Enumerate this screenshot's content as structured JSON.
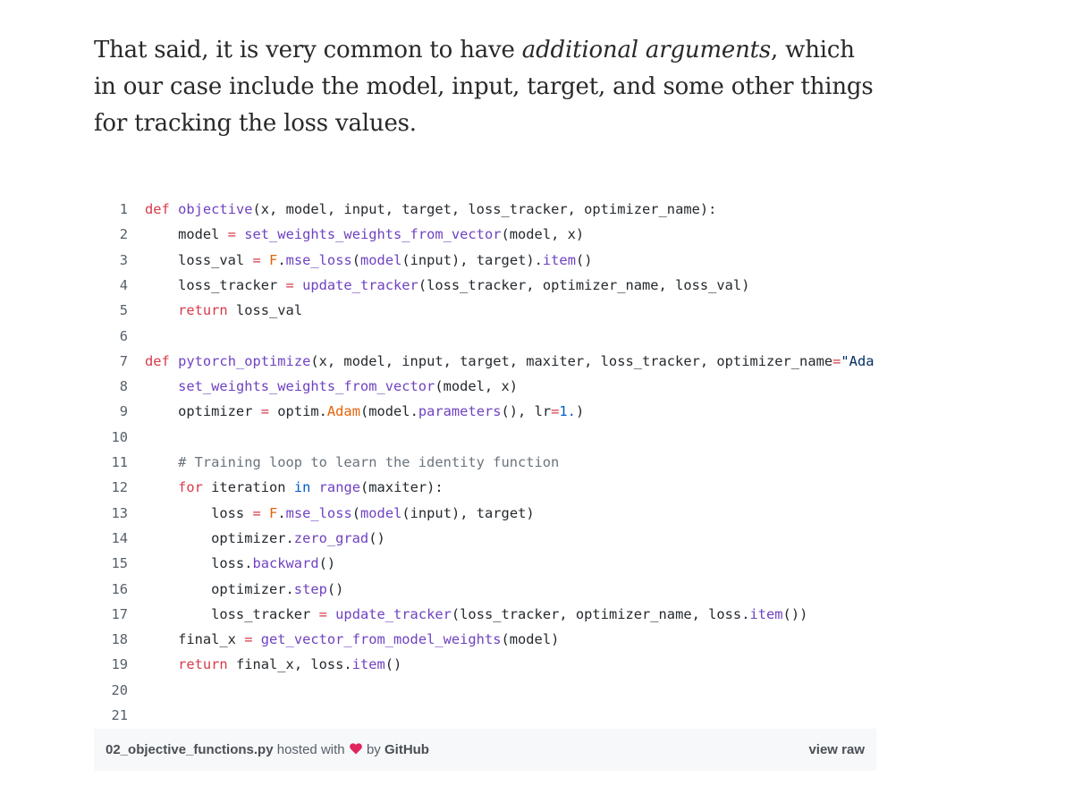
{
  "article": {
    "paragraph_before": "That said, it is very common to have ",
    "paragraph_emphasis": "additional arguments",
    "paragraph_after": ", which in our case include the model, input, target, and some other things for tracking the loss values."
  },
  "gist": {
    "filename": "02_objective_functions.py",
    "hosted_with": "hosted with",
    "by": "by",
    "host": "GitHub",
    "view_raw": "view raw",
    "heart_icon": "heart-icon",
    "colors": {
      "keyword": "#d73a49",
      "function": "#6f42c1",
      "number": "#005cc5",
      "string": "#032f62",
      "comment": "#6a737d",
      "class": "#e36209",
      "meta_background": "#f6f8fa",
      "heart": "#e0245e"
    },
    "lines": [
      {
        "n": "1",
        "tokens": [
          {
            "t": "def",
            "c": "kw"
          },
          {
            "t": " "
          },
          {
            "t": "objective",
            "c": "fn"
          },
          {
            "t": "(x, model, input, target, loss_tracker, optimizer_name):"
          }
        ]
      },
      {
        "n": "2",
        "tokens": [
          {
            "t": "    model "
          },
          {
            "t": "=",
            "c": "kw"
          },
          {
            "t": " "
          },
          {
            "t": "set_weights_weights_from_vector",
            "c": "fn"
          },
          {
            "t": "(model, x)"
          }
        ]
      },
      {
        "n": "3",
        "tokens": [
          {
            "t": "    loss_val "
          },
          {
            "t": "=",
            "c": "kw"
          },
          {
            "t": " "
          },
          {
            "t": "F",
            "c": "cls"
          },
          {
            "t": "."
          },
          {
            "t": "mse_loss",
            "c": "fn"
          },
          {
            "t": "("
          },
          {
            "t": "model",
            "c": "fn"
          },
          {
            "t": "(input), target)."
          },
          {
            "t": "item",
            "c": "fn"
          },
          {
            "t": "()"
          }
        ]
      },
      {
        "n": "4",
        "tokens": [
          {
            "t": "    loss_tracker "
          },
          {
            "t": "=",
            "c": "kw"
          },
          {
            "t": " "
          },
          {
            "t": "update_tracker",
            "c": "fn"
          },
          {
            "t": "(loss_tracker, optimizer_name, loss_val)"
          }
        ]
      },
      {
        "n": "5",
        "tokens": [
          {
            "t": "    "
          },
          {
            "t": "return",
            "c": "kw"
          },
          {
            "t": " loss_val"
          }
        ]
      },
      {
        "n": "6",
        "tokens": []
      },
      {
        "n": "7",
        "tokens": [
          {
            "t": "def",
            "c": "kw"
          },
          {
            "t": " "
          },
          {
            "t": "pytorch_optimize",
            "c": "fn"
          },
          {
            "t": "(x, model, input, target, maxiter, loss_tracker, optimizer_name"
          },
          {
            "t": "=",
            "c": "kw"
          },
          {
            "t": "\"Ada",
            "c": "str"
          }
        ]
      },
      {
        "n": "8",
        "tokens": [
          {
            "t": "    "
          },
          {
            "t": "set_weights_weights_from_vector",
            "c": "fn"
          },
          {
            "t": "(model, x)"
          }
        ]
      },
      {
        "n": "9",
        "tokens": [
          {
            "t": "    optimizer "
          },
          {
            "t": "=",
            "c": "kw"
          },
          {
            "t": " optim."
          },
          {
            "t": "Adam",
            "c": "cls"
          },
          {
            "t": "(model."
          },
          {
            "t": "parameters",
            "c": "fn"
          },
          {
            "t": "(), lr"
          },
          {
            "t": "=",
            "c": "kw"
          },
          {
            "t": "1.",
            "c": "num"
          },
          {
            "t": ")"
          }
        ]
      },
      {
        "n": "10",
        "tokens": []
      },
      {
        "n": "11",
        "tokens": [
          {
            "t": "    "
          },
          {
            "t": "# Training loop to learn the identity function",
            "c": "cm"
          }
        ]
      },
      {
        "n": "12",
        "tokens": [
          {
            "t": "    "
          },
          {
            "t": "for",
            "c": "kw"
          },
          {
            "t": " iteration "
          },
          {
            "t": "in",
            "c": "num"
          },
          {
            "t": " "
          },
          {
            "t": "range",
            "c": "fn"
          },
          {
            "t": "(maxiter):"
          }
        ]
      },
      {
        "n": "13",
        "tokens": [
          {
            "t": "        loss "
          },
          {
            "t": "=",
            "c": "kw"
          },
          {
            "t": " "
          },
          {
            "t": "F",
            "c": "cls"
          },
          {
            "t": "."
          },
          {
            "t": "mse_loss",
            "c": "fn"
          },
          {
            "t": "("
          },
          {
            "t": "model",
            "c": "fn"
          },
          {
            "t": "(input), target)"
          }
        ]
      },
      {
        "n": "14",
        "tokens": [
          {
            "t": "        optimizer."
          },
          {
            "t": "zero_grad",
            "c": "fn"
          },
          {
            "t": "()"
          }
        ]
      },
      {
        "n": "15",
        "tokens": [
          {
            "t": "        loss."
          },
          {
            "t": "backward",
            "c": "fn"
          },
          {
            "t": "()"
          }
        ]
      },
      {
        "n": "16",
        "tokens": [
          {
            "t": "        optimizer."
          },
          {
            "t": "step",
            "c": "fn"
          },
          {
            "t": "()"
          }
        ]
      },
      {
        "n": "17",
        "tokens": [
          {
            "t": "        loss_tracker "
          },
          {
            "t": "=",
            "c": "kw"
          },
          {
            "t": " "
          },
          {
            "t": "update_tracker",
            "c": "fn"
          },
          {
            "t": "(loss_tracker, optimizer_name, loss."
          },
          {
            "t": "item",
            "c": "fn"
          },
          {
            "t": "())"
          }
        ]
      },
      {
        "n": "18",
        "tokens": [
          {
            "t": "    final_x "
          },
          {
            "t": "=",
            "c": "kw"
          },
          {
            "t": " "
          },
          {
            "t": "get_vector_from_model_weights",
            "c": "fn"
          },
          {
            "t": "(model)"
          }
        ]
      },
      {
        "n": "19",
        "tokens": [
          {
            "t": "    "
          },
          {
            "t": "return",
            "c": "kw"
          },
          {
            "t": " final_x, loss."
          },
          {
            "t": "item",
            "c": "fn"
          },
          {
            "t": "()"
          }
        ]
      },
      {
        "n": "20",
        "tokens": []
      },
      {
        "n": "21",
        "tokens": []
      }
    ]
  }
}
